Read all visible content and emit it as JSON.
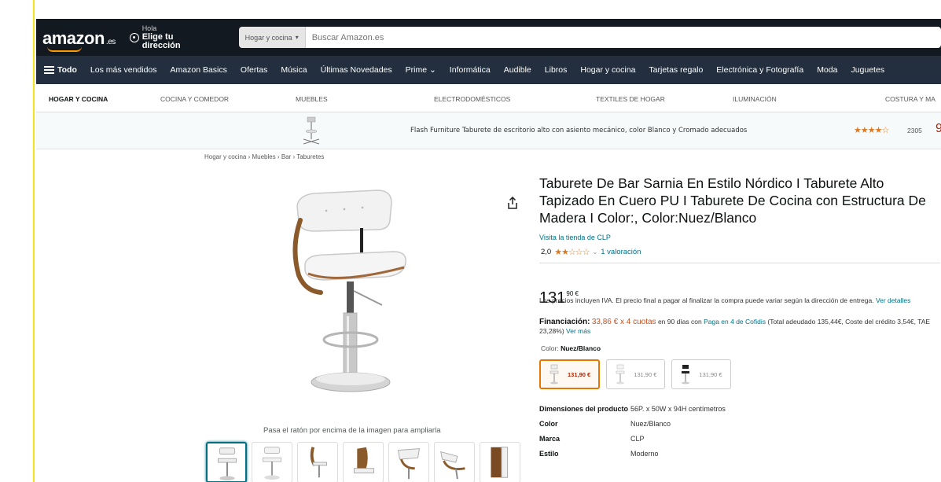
{
  "header": {
    "logo_text": "amazon",
    "logo_tld": ".es",
    "address_line1": "Hola",
    "address_line2": "Elige tu dirección",
    "search_category": "Hogar y cocina",
    "search_placeholder": "Buscar Amazon.es"
  },
  "subnav": {
    "todo": "Todo",
    "items": [
      "Los más vendidos",
      "Amazon Basics",
      "Ofertas",
      "Música",
      "Últimas Novedades",
      "Prime",
      "Informática",
      "Audible",
      "Libros",
      "Hogar y cocina",
      "Tarjetas regalo",
      "Electrónica y Fotografía",
      "Moda",
      "Juguetes"
    ]
  },
  "categories": [
    "HOGAR Y COCINA",
    "COCINA Y COMEDOR",
    "MUEBLES",
    "ELECTRODOMÉSTICOS",
    "TEXTILES DE HOGAR",
    "ILUMINACIÓN",
    "COSTURA Y MA"
  ],
  "ad": {
    "text": "Flash Furniture Taburete de escritorio alto con asiento mecánico, color Blanco y Cromado adecuados",
    "stars": "★★★★☆",
    "rating_count": "2305",
    "price": "9"
  },
  "breadcrumb": "Hogar y cocina › Muebles › Bar › Taburetes",
  "gallery": {
    "hint": "Pasa el ratón por encima de la imagen para ampliarla"
  },
  "product": {
    "title": "Taburete De Bar Sarnia En Estilo Nórdico I Taburete Alto Tapizado En Cuero PU I Taburete De Cocina con Estructura De Madera I Color:, Color:Nuez/Blanco",
    "store_link": "Visita la tienda de CLP",
    "rating_value": "2,0",
    "rating_stars": "★★☆☆☆",
    "rating_caret": "⌄",
    "rating_count": "1 valoración",
    "price_whole": "131",
    "price_fraction": "90 €",
    "tax_text": "Los precios incluyen IVA. El precio final a pagar al finalizar la compra puede variar según la dirección de entrega.",
    "tax_link": "Ver detalles",
    "financing_label": "Financiación:",
    "financing_amount": "33,86 € x 4 cuotas",
    "financing_mid": "en 90 días con",
    "financing_link": "Paga en 4 de Cofidis",
    "financing_rest": "(Total adeudado 135,44€, Coste del crédito 3,54€, TAE 23,28%)",
    "financing_more": "Ver más",
    "color_label": "Color:",
    "color_value": "Nuez/Blanco",
    "variants": [
      {
        "price": "131,90 €"
      },
      {
        "price": "131,90 €"
      },
      {
        "price": "131,90 €"
      }
    ],
    "specs": [
      {
        "key": "Dimensiones del producto",
        "value": "56P. x 50W x 94H centímetros"
      },
      {
        "key": "Color",
        "value": "Nuez/Blanco"
      },
      {
        "key": "Marca",
        "value": "CLP"
      },
      {
        "key": "Estilo",
        "value": "Moderno"
      }
    ]
  }
}
